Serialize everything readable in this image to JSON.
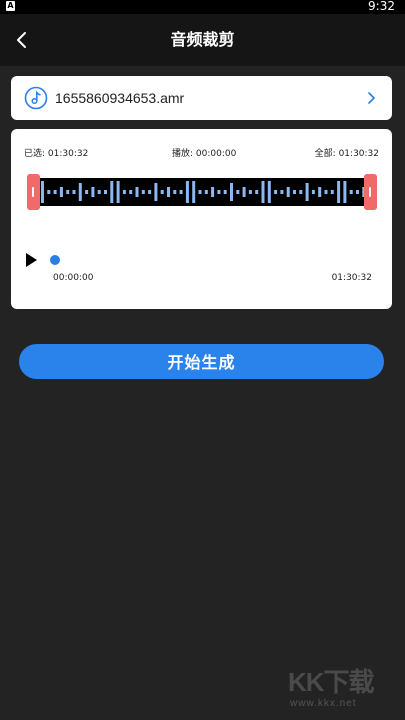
{
  "statusbar": {
    "indicator": "A",
    "time": "9:32"
  },
  "nav": {
    "title": "音频裁剪",
    "back_icon": "chevron-left-icon"
  },
  "file": {
    "name": "1655860934653.amr",
    "icon": "music-note-icon",
    "arrow_icon": "chevron-right-icon"
  },
  "editor": {
    "selected_label": "已选:",
    "selected_time": "01:30:32",
    "playing_label": "播放:",
    "playing_time": "00:00:00",
    "total_label": "全部:",
    "total_time": "01:30:32",
    "start_time": "00:00:00",
    "end_time": "01:30:32",
    "playback_progress": 0,
    "wave_color": "#8ab8f0",
    "handle_color": "#f06a6a"
  },
  "generate_button": {
    "label": "开始生成"
  },
  "watermark": {
    "logo": "KK下载",
    "url": "www.kkx.net"
  }
}
